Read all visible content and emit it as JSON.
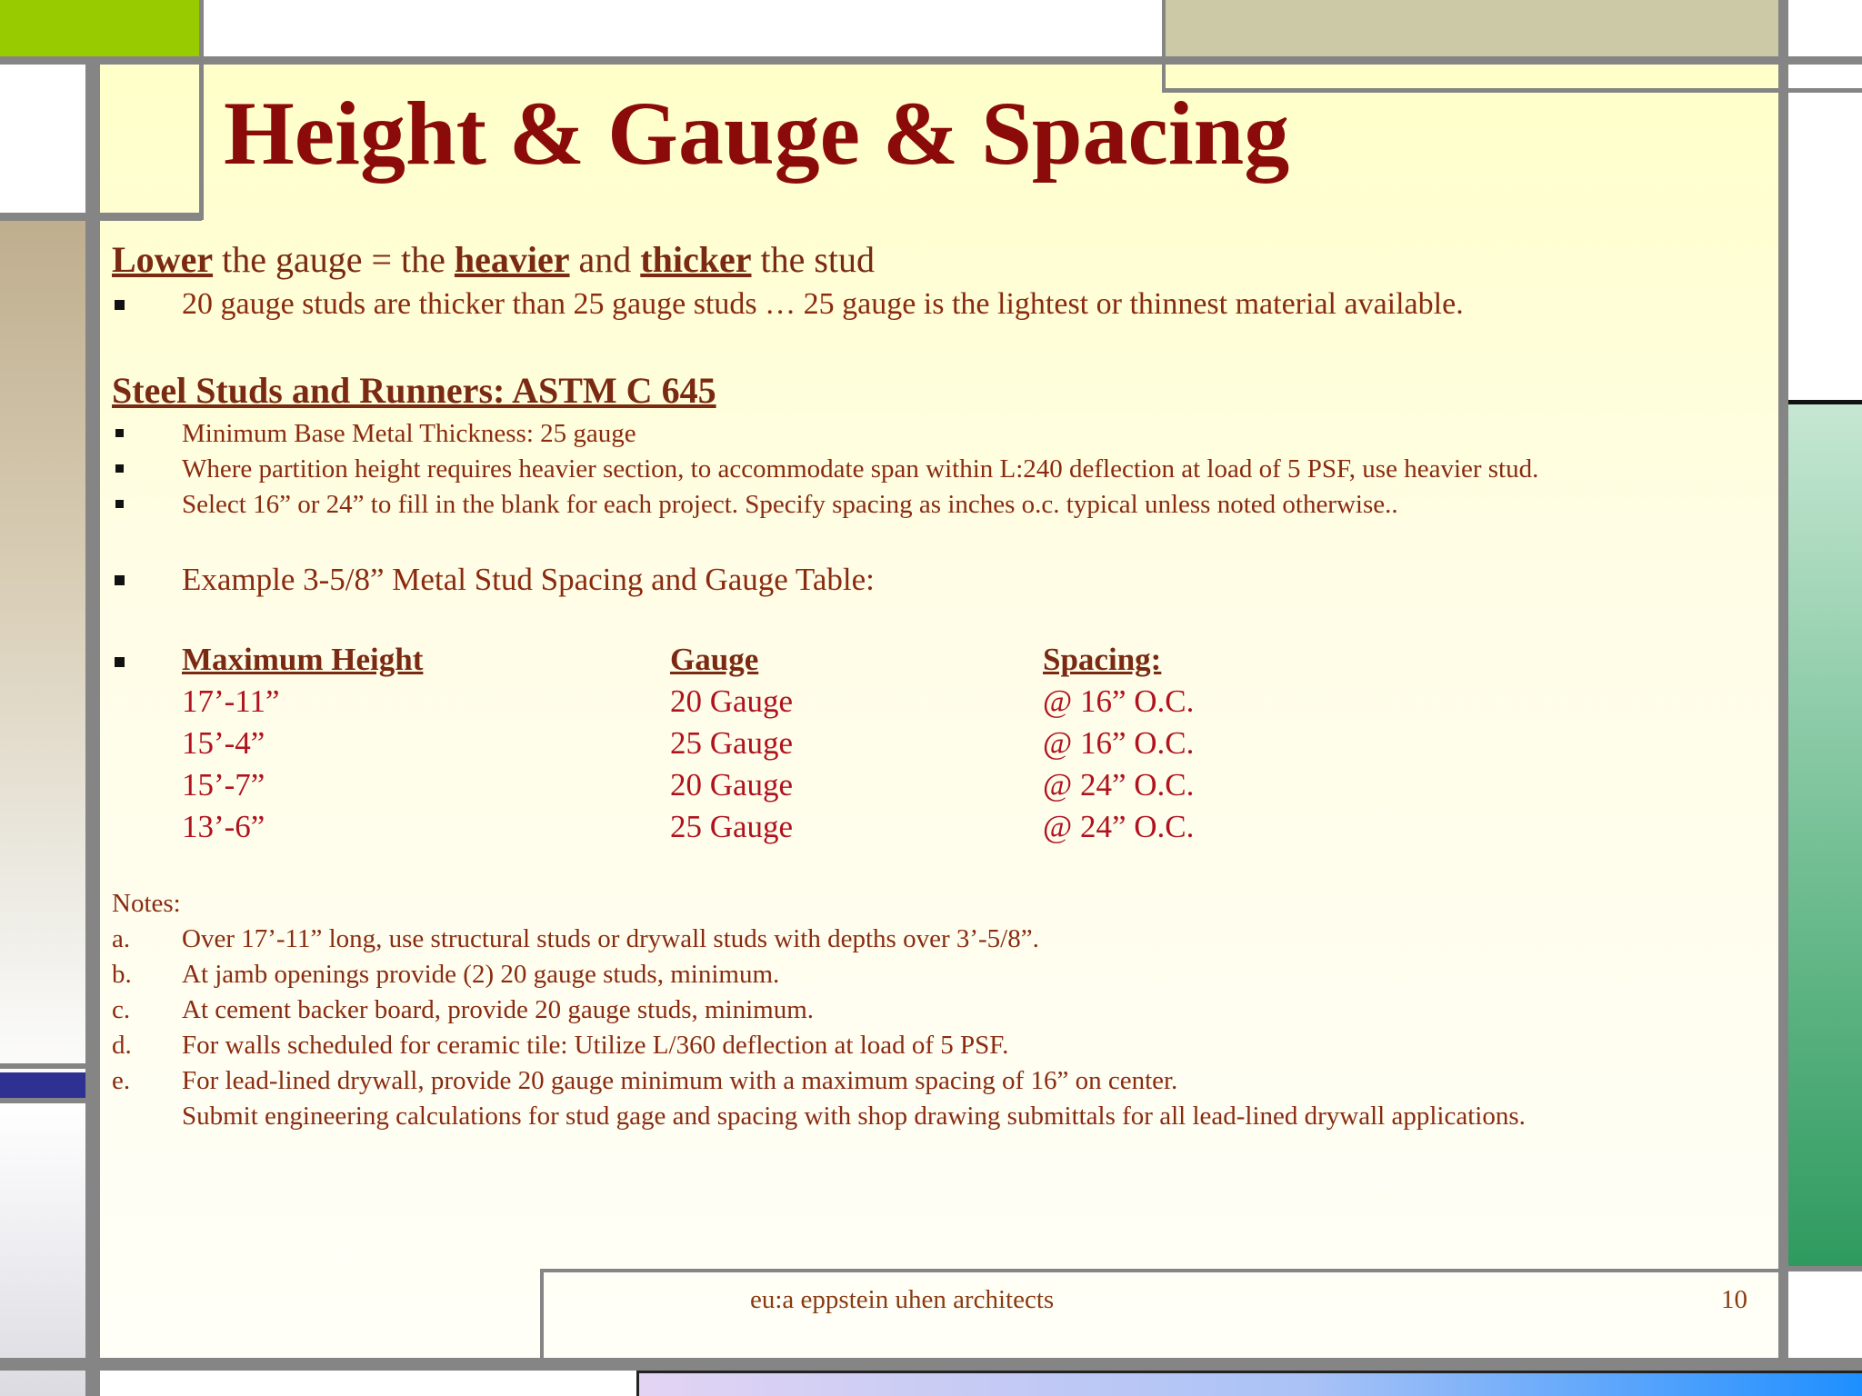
{
  "title": "Height & Gauge & Spacing",
  "intro": {
    "w1": "Lower",
    "t1": " the gauge = the ",
    "w2": "heavier",
    "t2": " and ",
    "w3": "thicker",
    "t3": " the stud"
  },
  "intro_bullet": "20 gauge studs are thicker than 25 gauge studs … 25 gauge is the lightest or thinnest material available.",
  "section_heading": "Steel Studs and Runners:  ASTM C 645",
  "section_bullets": [
    "Minimum Base Metal Thickness:  25 gauge",
    "Where partition height requires heavier section, to accommodate span within L:240 deflection at load of 5 PSF, use heavier stud.",
    "Select 16” or 24” to fill in the blank for each project. Specify spacing as inches o.c. typical unless noted otherwise.."
  ],
  "example_bullet": "Example 3-5/8” Metal Stud Spacing and Gauge Table:",
  "table": {
    "headers": [
      "Maximum Height",
      "Gauge",
      "Spacing:"
    ],
    "rows": [
      [
        "17’-11”",
        "20 Gauge",
        "@ 16” O.C."
      ],
      [
        "15’-4”",
        "25 Gauge",
        "@ 16” O.C."
      ],
      [
        "15’-7”",
        "20 Gauge",
        "@ 24” O.C."
      ],
      [
        "13’-6”",
        "25 Gauge",
        "@ 24” O.C."
      ]
    ]
  },
  "notes": {
    "label": "Notes:",
    "items": [
      {
        "marker": "a.",
        "text": "Over 17’-11” long, use structural studs or drywall studs with depths over 3’-5/8”."
      },
      {
        "marker": "b.",
        "text": "At jamb openings provide (2) 20 gauge studs, minimum."
      },
      {
        "marker": "c.",
        "text": "At cement backer board, provide 20 gauge studs, minimum."
      },
      {
        "marker": "d.",
        "text": "For walls scheduled for  ceramic tile:  Utilize L/360 deflection at load of 5 PSF."
      },
      {
        "marker": "e.",
        "text": "For lead-lined drywall, provide 20 gauge minimum with a maximum spacing of 16” on center."
      }
    ],
    "continuation": "Submit engineering calculations for stud gage and spacing with shop drawing submittals for all lead-lined drywall applications."
  },
  "footer": {
    "company": "eu:a   eppstein uhen architects",
    "page_number": "10"
  },
  "colors": {
    "title": "#8b0a0a",
    "body_text": "#8a2b10",
    "table_values": "#b0121e",
    "frame": "#858585",
    "accent_green": "#99cc00",
    "accent_lightgreen": "#d2e86a",
    "accent_tan": "#cbc9a6"
  }
}
